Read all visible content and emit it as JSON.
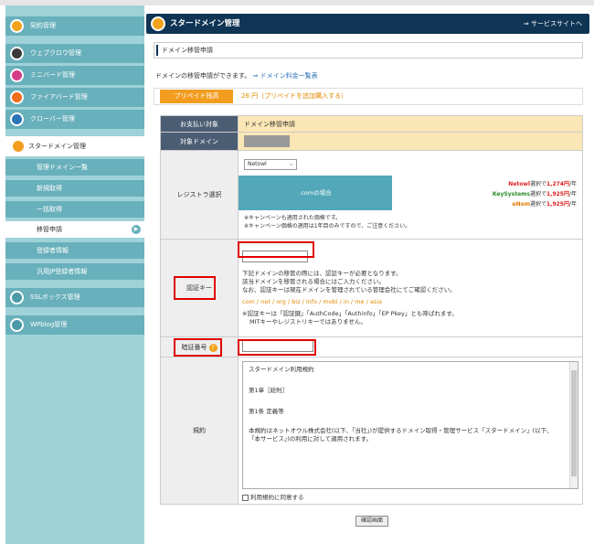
{
  "sidebar": {
    "items": [
      {
        "label": "契約管理",
        "icon": "contract-icon"
      },
      {
        "label": "ウェブクロウ管理",
        "icon": "crow-icon"
      },
      {
        "label": "ミニバード管理",
        "icon": "minibird-icon"
      },
      {
        "label": "ファイアバード管理",
        "icon": "firebird-icon"
      },
      {
        "label": "クローバー管理",
        "icon": "clover-icon"
      }
    ],
    "active": {
      "label": "スタードメイン管理",
      "icon": "stardomain-icon"
    },
    "sub": [
      "管理ドメイン一覧",
      "新規取得",
      "一括取得",
      "移管申請",
      "登録者情報",
      "汎用JP登録者情報"
    ],
    "bottom": [
      {
        "label": "SSLボックス管理",
        "icon": "ssl-icon"
      },
      {
        "label": "WPblog管理",
        "icon": "wpblog-icon"
      }
    ]
  },
  "header": {
    "title": "スタードメイン管理",
    "service_link": "⇒ サービスサイトへ"
  },
  "section": {
    "title": "ドメイン移管申請"
  },
  "intro": {
    "text": "ドメインの移管申請ができます。",
    "link": "⇒ ドメイン料金一覧表"
  },
  "prepaid": {
    "label": "プリペイド残高",
    "value": "26 円（プリペイドを追加購入する）"
  },
  "form": {
    "payment_label": "お支払い対象",
    "payment_value": "ドメイン移管申請",
    "domain_label": "対象ドメイン",
    "registrar_label": "レジストラ選択",
    "registrar_select": "Netowl",
    "com_case": ".comの場合",
    "prices": [
      {
        "name": "Netowl",
        "text": "選択で",
        "price": "1,274円",
        "unit": "/年"
      },
      {
        "name": "KeySystems",
        "text": "選択で",
        "price": "1,925円",
        "unit": "/年"
      },
      {
        "name": "eNom",
        "text": "選択で",
        "price": "1,925円",
        "unit": "/年"
      }
    ],
    "note1": "※キャンペーンも適用された価格です。",
    "note2": "※キャンペーン価格の適用は1年目のみですので、ご注意ください。",
    "authkey_label": "認証キー",
    "auth_text1": "下記ドメインの移管の際には、認証キーが必要となります。",
    "auth_text2": "該当ドメインを移管される場合にはご入力ください。",
    "auth_text3": "なお、認証キーは現在ドメインを管理されている管理会社にてご確認ください。",
    "auth_tlds": "com / net / org / biz / info / mobi / in / me / asia",
    "auth_note1": "※認証キーは「認証鍵」「AuthCode」「Authinfo」「EP Pkey」とも呼ばれます。",
    "auth_note2": "MITキーやレジストリキーではありません。",
    "pin_label": "暗証番号",
    "terms_label": "規約",
    "terms_lines": [
      "スタードメイン利用規約",
      "第1章［総則］",
      "第1条 定義等",
      "本規約はネットオウル株式会社(以下、「当社」)が提供するドメイン取得・管理サービス「スタードメイン」(以下、",
      "「本サービス」)の利用に対して適用されます。"
    ],
    "agree_label": "利用規約に同意する"
  },
  "confirm_button": "確認画面",
  "colors": {
    "navy": "#0f3454",
    "teal": "#68b0bb",
    "orange": "#f29d1f",
    "red_highlight": "#e00000"
  }
}
